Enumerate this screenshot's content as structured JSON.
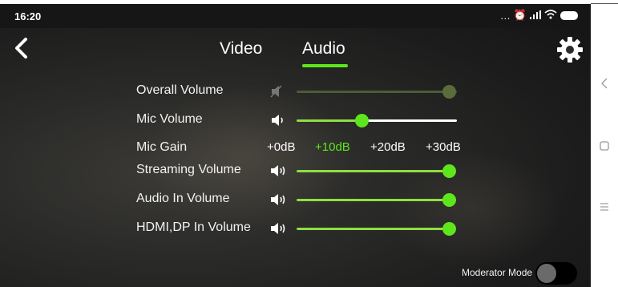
{
  "status_bar": {
    "time": "16:20",
    "icons": [
      "more-icon",
      "alarm-off-icon",
      "signal-icon",
      "wifi-icon",
      "battery-icon"
    ]
  },
  "header": {
    "tabs": [
      {
        "label": "Video",
        "active": false
      },
      {
        "label": "Audio",
        "active": true
      }
    ],
    "accent_color": "#5ee61c"
  },
  "controls": {
    "overall_volume": {
      "label": "Overall Volume",
      "muted": true,
      "level_percent": 100
    },
    "mic_volume": {
      "label": "Mic Volume",
      "level_percent": 41
    },
    "mic_gain": {
      "label": "Mic Gain",
      "options": [
        "+0dB",
        "+10dB",
        "+20dB",
        "+30dB"
      ],
      "selected": "+10dB"
    },
    "streaming_volume": {
      "label": "Streaming Volume",
      "level_percent": 100
    },
    "audio_in_volume": {
      "label": "Audio In Volume",
      "level_percent": 100
    },
    "hdmi_dp_in_volume": {
      "label": "HDMI,DP In Volume",
      "level_percent": 100
    }
  },
  "moderator_mode": {
    "label": "Moderator Mode",
    "enabled": false
  },
  "nav_bar": {
    "icons": [
      "back-nav-icon",
      "home-nav-icon",
      "menu-nav-icon"
    ]
  }
}
